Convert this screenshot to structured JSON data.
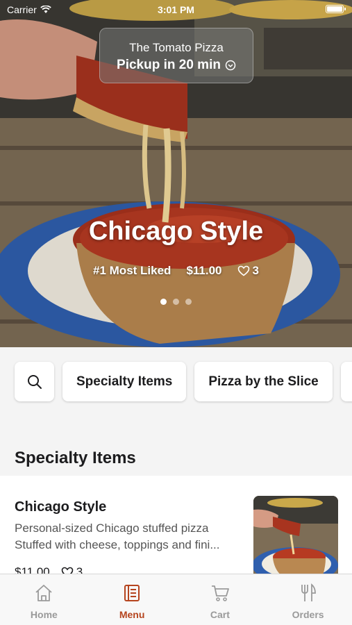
{
  "status_bar": {
    "carrier": "Carrier",
    "time": "3:01 PM"
  },
  "pickup": {
    "store_name": "The Tomato Pizza",
    "pickup_text": "Pickup in 20 min"
  },
  "hero": {
    "title": "Chicago Style",
    "rank": "#1 Most Liked",
    "price": "$11.00",
    "likes": "3",
    "carousel": {
      "pages": 3,
      "active": 1
    }
  },
  "categories": [
    "Specialty Items",
    "Pizza by the Slice"
  ],
  "section": {
    "title": "Specialty Items"
  },
  "menu_items": [
    {
      "name": "Chicago Style",
      "desc_line1": "Personal-sized Chicago stuffed pizza",
      "desc_line2": "Stuffed with cheese, toppings and fini...",
      "price": "$11.00",
      "likes": "3"
    }
  ],
  "tabs": [
    {
      "label": "Home",
      "icon": "home-icon"
    },
    {
      "label": "Menu",
      "icon": "menu-book-icon",
      "active": true
    },
    {
      "label": "Cart",
      "icon": "cart-icon"
    },
    {
      "label": "Orders",
      "icon": "fork-knife-icon"
    }
  ],
  "colors": {
    "accent": "#b5441e",
    "tab_inactive": "#9a9a9a",
    "section_bg": "#f4f4f4"
  }
}
